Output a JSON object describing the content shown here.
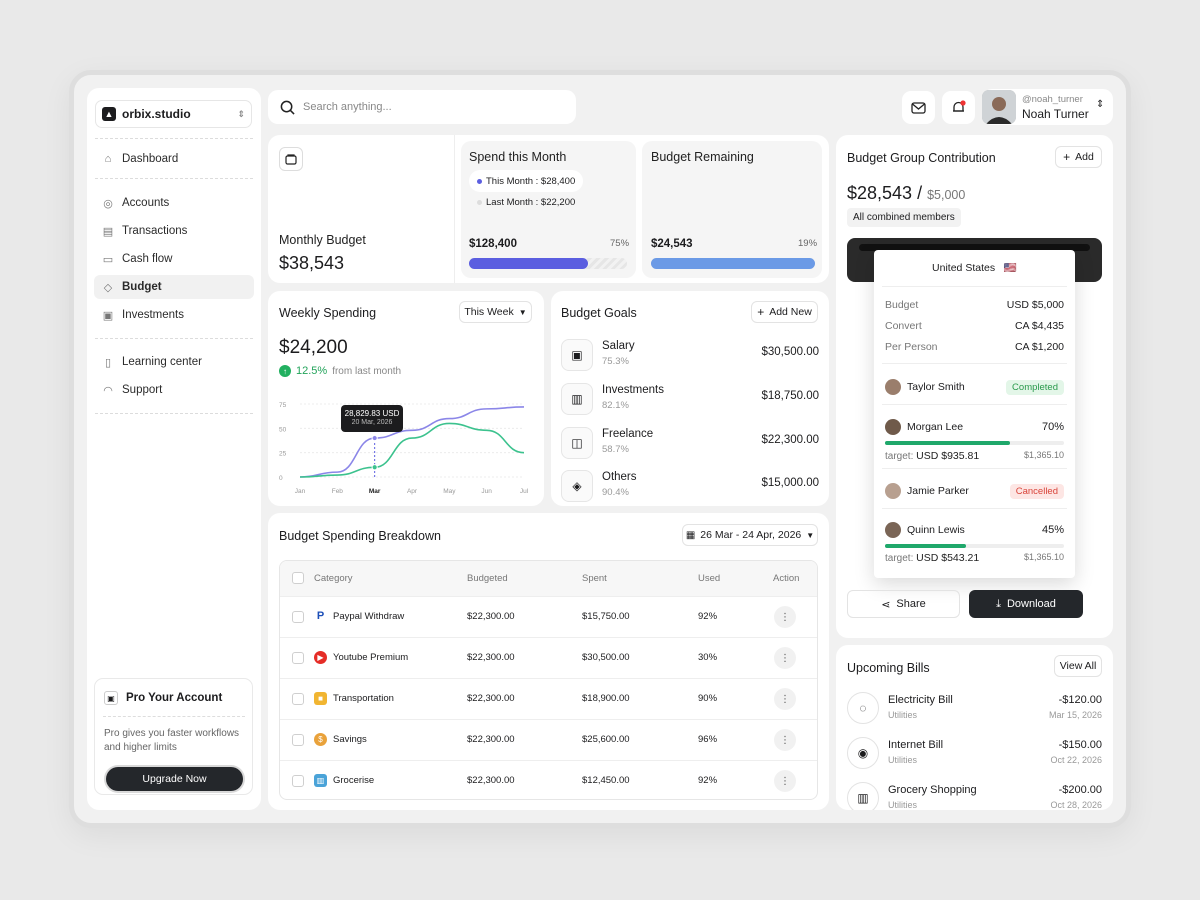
{
  "brand": {
    "name": "orbix.studio"
  },
  "nav": {
    "dashboard": "Dashboard",
    "accounts": "Accounts",
    "transactions": "Transactions",
    "cashflow": "Cash flow",
    "budget": "Budget",
    "investments": "Investments",
    "learning": "Learning center",
    "support": "Support"
  },
  "pro": {
    "title": "Pro Your Account",
    "desc": "Pro gives you faster workflows and higher limits",
    "button": "Upgrade Now"
  },
  "search": {
    "placeholder": "Search anything..."
  },
  "user": {
    "handle": "@noah_turner",
    "name": "Noah Turner"
  },
  "monthly": {
    "label": "Monthly Budget",
    "value": "$38,543"
  },
  "spend": {
    "title": "Spend this Month",
    "this": "This Month : $28,400",
    "last": "Last Month : $22,200",
    "value": "$128,400",
    "pct": "75%",
    "fill": 0.75
  },
  "remaining": {
    "title": "Budget Remaining",
    "value": "$24,543",
    "pct": "19%",
    "fill": 1.0
  },
  "weekly": {
    "title": "Weekly Spending",
    "filter": "This Week",
    "value": "$24,200",
    "change": "12.5%",
    "change_note": "from last month",
    "tooltip_value": "28,829.83 USD",
    "tooltip_date": "20 Mar, 2026"
  },
  "chart_data": {
    "type": "line",
    "categories": [
      "Jan",
      "Feb",
      "Mar",
      "Apr",
      "May",
      "Jun",
      "Jul"
    ],
    "yticks": [
      "75",
      "50",
      "25",
      "0"
    ],
    "ylim": [
      0,
      75
    ],
    "series": [
      {
        "color": "#8b86e8",
        "values": [
          0,
          5,
          40,
          48,
          60,
          70,
          72
        ]
      },
      {
        "color": "#3cc28e",
        "values": [
          0,
          2,
          10,
          40,
          55,
          48,
          25
        ]
      }
    ]
  },
  "goals": {
    "title": "Budget Goals",
    "add": "Add New",
    "items": [
      {
        "name": "Salary",
        "pct": "75.3%",
        "value": "$30,500.00"
      },
      {
        "name": "Investments",
        "pct": "82.1%",
        "value": "$18,750.00"
      },
      {
        "name": "Freelance",
        "pct": "58.7%",
        "value": "$22,300.00"
      },
      {
        "name": "Others",
        "pct": "90.4%",
        "value": "$15,000.00"
      }
    ]
  },
  "breakdown": {
    "title": "Budget Spending Breakdown",
    "range": "26 Mar - 24 Apr, 2026",
    "headers": {
      "category": "Category",
      "budgeted": "Budgeted",
      "spent": "Spent",
      "used": "Used",
      "action": "Action"
    },
    "rows": [
      {
        "category": "Paypal Withdraw",
        "budgeted": "$22,300.00",
        "spent": "$15,750.00",
        "used": "92%"
      },
      {
        "category": "Youtube Premium",
        "budgeted": "$22,300.00",
        "spent": "$30,500.00",
        "used": "30%"
      },
      {
        "category": "Transportation",
        "budgeted": "$22,300.00",
        "spent": "$18,900.00",
        "used": "90%"
      },
      {
        "category": "Savings",
        "budgeted": "$22,300.00",
        "spent": "$25,600.00",
        "used": "96%"
      },
      {
        "category": "Grocerise",
        "budgeted": "$22,300.00",
        "spent": "$12,450.00",
        "used": "92%"
      }
    ]
  },
  "group": {
    "title": "Budget Group Contribution",
    "add": "Add",
    "amount": "$28,543 /",
    "amount_of": "$5,000",
    "members": "All combined members",
    "country": "United States",
    "flag": "🇺🇸",
    "budget_k": "Budget",
    "budget_v": "USD $5,000",
    "convert_k": "Convert",
    "convert_v": "CA $4,435",
    "per_k": "Per Person",
    "per_v": "CA $1,200",
    "p1": {
      "name": "Taylor Smith",
      "status": "Completed"
    },
    "p2": {
      "name": "Morgan Lee",
      "pct": "70%",
      "fill": 0.7,
      "target_label": "target:",
      "target": "USD $935.81",
      "total": "$1,365.10"
    },
    "p3": {
      "name": "Jamie Parker",
      "status": "Cancelled"
    },
    "p4": {
      "name": "Quinn Lewis",
      "pct": "45%",
      "fill": 0.45,
      "target_label": "target:",
      "target": "USD $543.21",
      "total": "$1,365.10"
    },
    "share": "Share",
    "download": "Download"
  },
  "bills": {
    "title": "Upcoming Bills",
    "view": "View All",
    "items": [
      {
        "name": "Electricity Bill",
        "cat": "Utilities",
        "amount": "-$120.00",
        "date": "Mar 15, 2026"
      },
      {
        "name": "Internet Bill",
        "cat": "Utilities",
        "amount": "-$150.00",
        "date": "Oct 22, 2026"
      },
      {
        "name": "Grocery Shopping",
        "cat": "Utilities",
        "amount": "-$200.00",
        "date": "Oct 28, 2026"
      }
    ]
  }
}
